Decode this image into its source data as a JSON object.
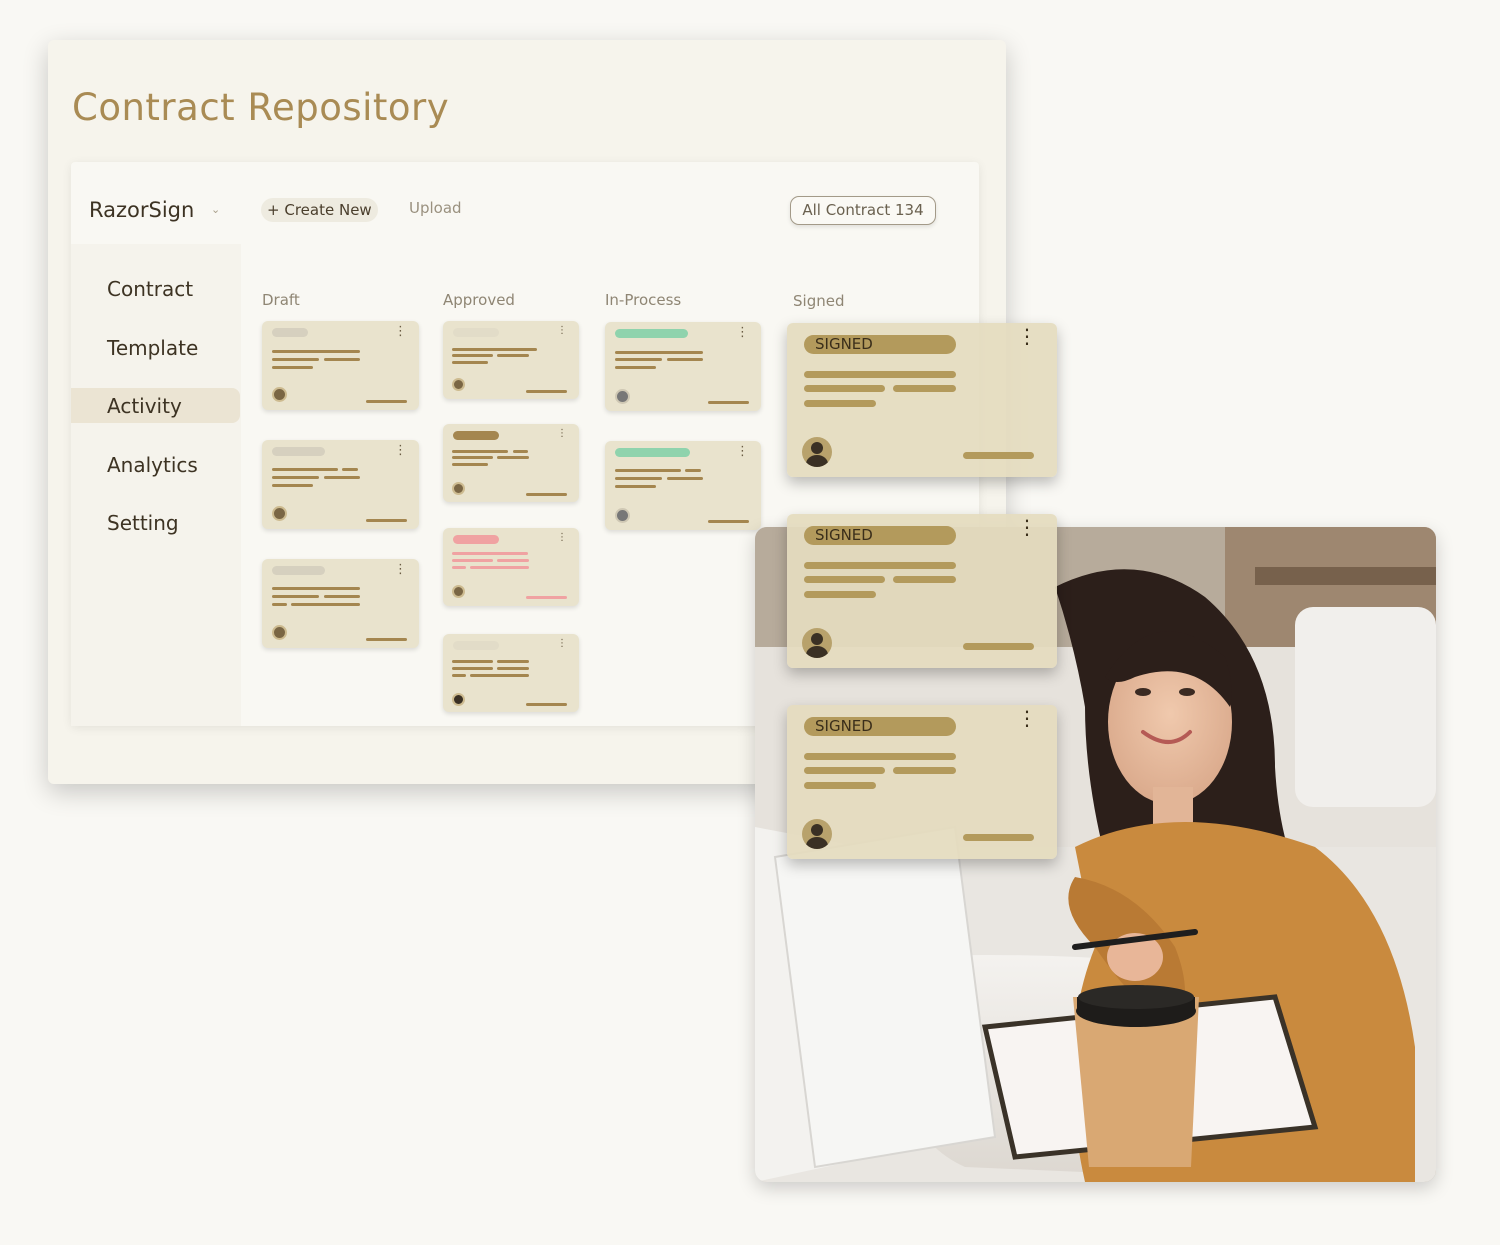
{
  "page": {
    "title": "Contract Repository"
  },
  "header": {
    "brand": "RazorSign",
    "create_icon": "+",
    "create_label": "Create New",
    "upload_label": "Upload",
    "all_contract_label": "All Contract 134"
  },
  "sidebar": {
    "items": [
      {
        "label": "Contract"
      },
      {
        "label": "Template"
      },
      {
        "label": "Activity",
        "active": true
      },
      {
        "label": "Analytics"
      },
      {
        "label": "Setting"
      }
    ]
  },
  "board": {
    "columns": [
      {
        "label": "Draft"
      },
      {
        "label": "Approved"
      },
      {
        "label": "In-Process"
      },
      {
        "label": "Signed"
      }
    ],
    "signed_cards": [
      {
        "status": "SIGNED"
      },
      {
        "status": "SIGNED"
      },
      {
        "status": "SIGNED"
      }
    ]
  },
  "colors": {
    "title": "#a98b54",
    "card_bg": "#e9e3cd",
    "bar": "#a4864f",
    "tag_gray": "#d6d0bf",
    "tag_green": "#8fd3ad",
    "tag_pink": "#f0a2a2",
    "signed_pill": "#b39a5c"
  },
  "icons": {
    "brand_dropdown": "chevron-down-icon",
    "card_menu": "kebab-menu-icon",
    "avatar": "user-avatar-icon"
  }
}
